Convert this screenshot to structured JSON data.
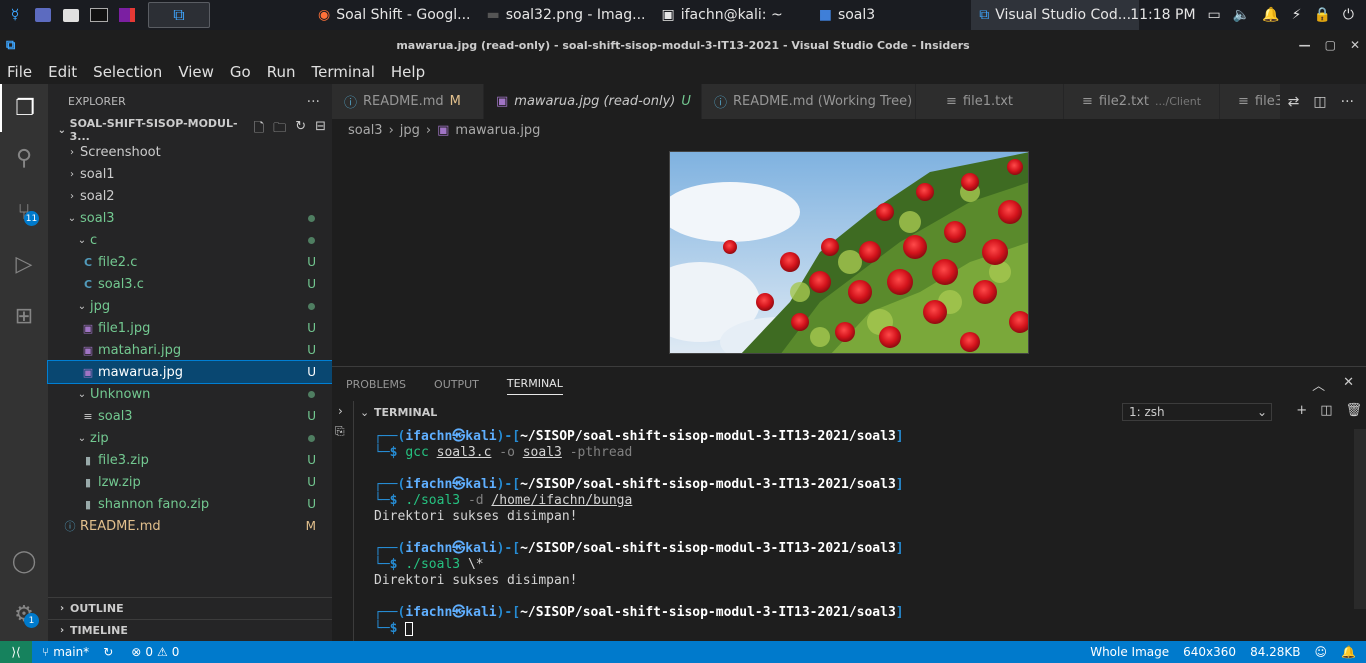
{
  "taskbar": {
    "windows": [
      {
        "label": "Soal Shift - Googl...",
        "icon": "firefox-icon"
      },
      {
        "label": "soal32.png - Imag...",
        "icon": "image-viewer-icon"
      },
      {
        "label": "ifachn@kali: ~",
        "icon": "terminal-icon"
      },
      {
        "label": "soal3",
        "icon": "folder-icon"
      },
      {
        "label": "Visual Studio Cod...",
        "icon": "vscode-icon",
        "badge": "3"
      }
    ],
    "clock": "11:18 PM"
  },
  "titlebar": {
    "title": "mawarua.jpg (read-only) - soal-shift-sisop-modul-3-IT13-2021 - Visual Studio Code - Insiders"
  },
  "menu": [
    "File",
    "Edit",
    "Selection",
    "View",
    "Go",
    "Run",
    "Terminal",
    "Help"
  ],
  "activity": {
    "scm_badge": "11",
    "settings_badge": "1"
  },
  "sidebar": {
    "title": "EXPLORER",
    "more": "···",
    "root": "SOAL-SHIFT-SISOP-MODUL-3...",
    "tree": [
      {
        "label": "Screenshoot",
        "status": ""
      },
      {
        "label": "soal1",
        "status": ""
      },
      {
        "label": "soal2",
        "status": ""
      },
      {
        "label": "soal3",
        "status": ""
      },
      {
        "label": "c",
        "status": ""
      },
      {
        "label": "file2.c",
        "status": "U"
      },
      {
        "label": "soal3.c",
        "status": "U"
      },
      {
        "label": "jpg",
        "status": ""
      },
      {
        "label": "file1.jpg",
        "status": "U"
      },
      {
        "label": "matahari.jpg",
        "status": "U"
      },
      {
        "label": "mawarua.jpg",
        "status": "U"
      },
      {
        "label": "Unknown",
        "status": ""
      },
      {
        "label": "soal3",
        "status": "U"
      },
      {
        "label": "zip",
        "status": ""
      },
      {
        "label": "file3.zip",
        "status": "U"
      },
      {
        "label": "lzw.zip",
        "status": "U"
      },
      {
        "label": "shannon fano.zip",
        "status": "U"
      },
      {
        "label": "README.md",
        "status": "M"
      }
    ],
    "outline": "OUTLINE",
    "timeline": "TIMELINE"
  },
  "tabs": [
    {
      "label": "README.md",
      "status": "M"
    },
    {
      "label": "mawarua.jpg (read-only)",
      "status": "U"
    },
    {
      "label": "README.md (Working Tree)",
      "status": "M"
    },
    {
      "label": "file1.txt",
      "status": ""
    },
    {
      "label": "file2.txt",
      "status": ".../Client"
    },
    {
      "label": "file3",
      "status": ""
    }
  ],
  "breadcrumb": [
    "soal3",
    "jpg",
    "mawarua.jpg"
  ],
  "panel": {
    "tabs": [
      "PROBLEMS",
      "OUTPUT",
      "TERMINAL"
    ],
    "terminal_title": "TERMINAL",
    "shell_select": "1: zsh"
  },
  "terminal": {
    "user": "ifachn",
    "host": "kali",
    "path": "~/SISOP/soal-shift-sisop-modul-3-IT13-2021/soal3",
    "cmd1": {
      "prog": "gcc",
      "a1": "soal3.c",
      "a2": "-o",
      "a3": "soal3",
      "a4": "-pthread"
    },
    "cmd2": {
      "prog": "./soal3",
      "a1": "-d",
      "a2": "/home/ifachn/bunga"
    },
    "out2": "Direktori sukses disimpan!",
    "cmd3": {
      "prog": "./soal3",
      "a1": "\\*"
    },
    "out3": "Direktori sukses disimpan!"
  },
  "status": {
    "branch": "main*",
    "errors": "0",
    "warnings": "0",
    "whole_image": "Whole Image",
    "dims": "640x360",
    "size": "84.28KB"
  }
}
